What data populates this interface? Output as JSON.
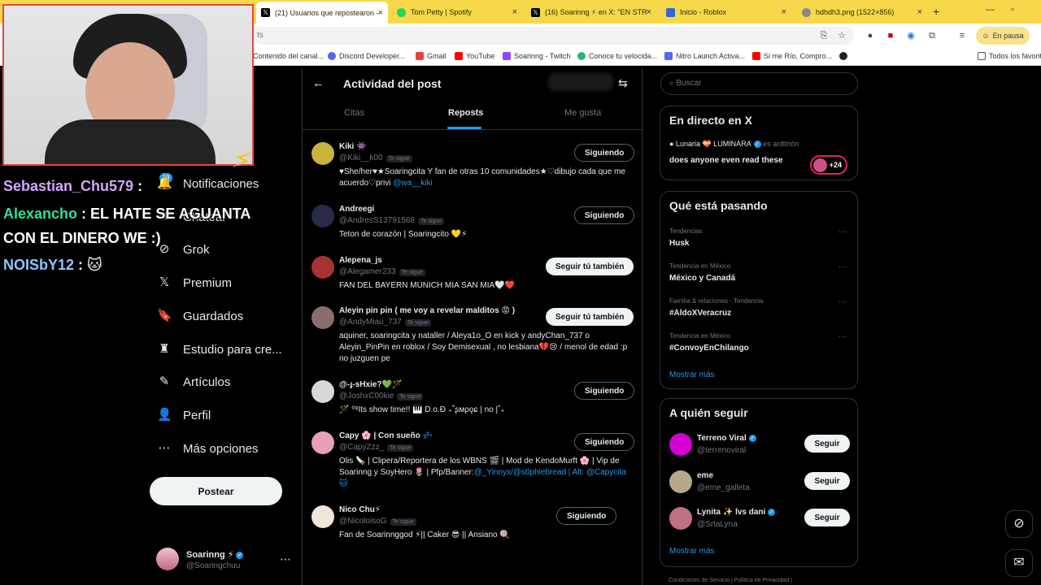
{
  "browser": {
    "tabs": [
      {
        "title": "(21) Usuarios que repostearon -",
        "color": "#000000"
      },
      {
        "title": "Tom Petty | Spotify",
        "color": "#1ed760"
      },
      {
        "title": "(16) Soarinng ⚡ en X: \"EN STR",
        "color": "#000000"
      },
      {
        "title": "Inicio - Roblox",
        "color": "#3367d6"
      },
      {
        "title": "hdhdh3.png (1522×856)",
        "color": "#777777"
      }
    ],
    "new_tab": "+",
    "url_tail": "ts",
    "en_pausa": "En pausa",
    "bookmarks": [
      {
        "label": "Contenido del canal...",
        "color": "#ff0000"
      },
      {
        "label": "Discord Developer...",
        "color": "#5865f2"
      },
      {
        "label": "Gmail",
        "color": "#ea4335"
      },
      {
        "label": "YouTube",
        "color": "#ff0000"
      },
      {
        "label": "Soarinng - Twitch",
        "color": "#9146ff"
      },
      {
        "label": "Conoce tu velocida...",
        "color": "#2bb673"
      },
      {
        "label": "Nitro Launch Activa...",
        "color": "#5865f2"
      },
      {
        "label": "Si me Río, Compro...",
        "color": "#ff0000"
      }
    ],
    "all_bookmarks": "Todos los favorit"
  },
  "chat": {
    "line1_user": "Sebastian_Chu579",
    "line1_msg": ":",
    "line2_user": "Alexancho",
    "line2_msg": ": EL HATE SE AGUANTA",
    "line2_msg2": "CON EL DINERO WE :)",
    "line3_user": "NOISbY12",
    "line3_msg": ": 🐱"
  },
  "nav": {
    "badge": "19",
    "items": [
      {
        "label": "Notificaciones",
        "icon": "🔔"
      },
      {
        "label": "Chatear",
        "icon": "✉"
      },
      {
        "label": "Grok",
        "icon": "⊘"
      },
      {
        "label": "Premium",
        "icon": "𝕏"
      },
      {
        "label": "Guardados",
        "icon": "🔖"
      },
      {
        "label": "Estudio para cre...",
        "icon": "♜"
      },
      {
        "label": "Artículos",
        "icon": "✎"
      },
      {
        "label": "Perfil",
        "icon": "👤"
      },
      {
        "label": "Más opciones",
        "icon": "⋯"
      }
    ],
    "post_label": "Postear",
    "account_name": "Soarinng ⚡",
    "account_handle": "@Soaringchuu",
    "account_more": "⋯"
  },
  "main": {
    "title": "Actividad del post",
    "tabs": [
      "Citas",
      "Reposts",
      "Me gusta"
    ],
    "te_sigue": "Te sigue",
    "users": [
      {
        "name": "Kiki 👾",
        "handle": "@Kiki__k00",
        "bio": "♥She/her♥★Soaringcita Y fan de otras 10 comunidades★♡dibujo cada que me acuerdo♡privi",
        "link": "@wa__kiki",
        "button": "Siguiendo",
        "btype": "outline",
        "color": "#c8b43a"
      },
      {
        "name": "Andreegi",
        "handle": "@AndresS13791568",
        "bio": "Teton de corazón | Soaringcito 💛⚡",
        "link": "",
        "button": "Siguiendo",
        "btype": "outline",
        "color": "#2a2a4a"
      },
      {
        "name": "Alepena_js",
        "handle": "@Alegamer233",
        "bio": "FAN DEL BAYERN MUNICH MIA SAN MIA🤍❤️",
        "link": "",
        "button": "Seguir tú también",
        "btype": "solid",
        "color": "#a83232"
      },
      {
        "name": "Aleyin pin pin ( me voy a revelar malditos 😡 )",
        "handle": "@AndyMiau_737",
        "bio": "aquiner, soaringcita y nataller / Aleya1o_O en kick y andyChan_737 o Aleyin_PinPin en roblox / Soy Demisexual , no lesbiana💔😢 / menol de edad :p no juzguen pe",
        "link": "",
        "button": "Seguir tú también",
        "btype": "solid",
        "color": "#8a6e6e"
      },
      {
        "name": "@-ɟ-sHxie?💚🪄",
        "handle": "@JoshxC00kie",
        "bio": "🪄 ⁰⁸Its show time!! 🎹 D.o.Đ ₊˚ʂмρǫɕ | no |˚₊",
        "link": "",
        "button": "Siguiendo",
        "btype": "outline",
        "color": "#d8d8d8"
      },
      {
        "name": "Capy 🌸 | Con sueño 💤",
        "handle": "@CapyZzz_",
        "bio": "Olis 🪚 | Clipera/Reportera de los WBNS 🎬 | Mod de KendoMurft 🌸 | Vip de Soarinng y SoyHero 🌷 | Pfp/Banner:",
        "link": "@_Yinnyx/@s0phlebread | Alt: @Capycita 🐱",
        "button": "Siguiendo",
        "btype": "outline",
        "color": "#e8a0b8"
      },
      {
        "name": "Nico Chu⚡",
        "handle": "@NicoloisoG",
        "bio": "Fan de Soarinnggod ⚡|| Caker 😎 || Ansiano 🍭",
        "link": "",
        "button": "Siguiendo",
        "btype": "outline",
        "color": "#efe7da"
      }
    ]
  },
  "right": {
    "search_placeholder": "Buscar",
    "live_title": "En directo en X",
    "live_host": "Lunaria 💝 LUMINARA",
    "live_host_suffix": "es anfitrión",
    "live_text": "does anyone even read these",
    "live_count": "+24",
    "trends_title": "Qué está pasando",
    "trends": [
      {
        "cat": "Tendencias",
        "name": "Husk"
      },
      {
        "cat": "Tendencia en México",
        "name": "México y Canadá"
      },
      {
        "cat": "Familia & relaciones · Tendencia",
        "name": "#AldoXVeracruz"
      },
      {
        "cat": "Tendencia en México",
        "name": "#ConvoyEnChilango"
      }
    ],
    "show_more": "Mostrar más",
    "follow_title": "A quién seguir",
    "suggestions": [
      {
        "name": "Terreno Viral",
        "handle": "@terrenoviral",
        "button": "Seguir",
        "color": "#d400d4"
      },
      {
        "name": "eme",
        "handle": "@eme_galleta",
        "button": "Seguir",
        "color": "#b8a88a"
      },
      {
        "name": "Lynita ✨ lvs dani",
        "handle": "@SrtaLyna",
        "button": "Seguir",
        "color": "#c07080"
      }
    ],
    "footer": "Condiciones de Servicio   |   Política de Privacidad   |"
  }
}
